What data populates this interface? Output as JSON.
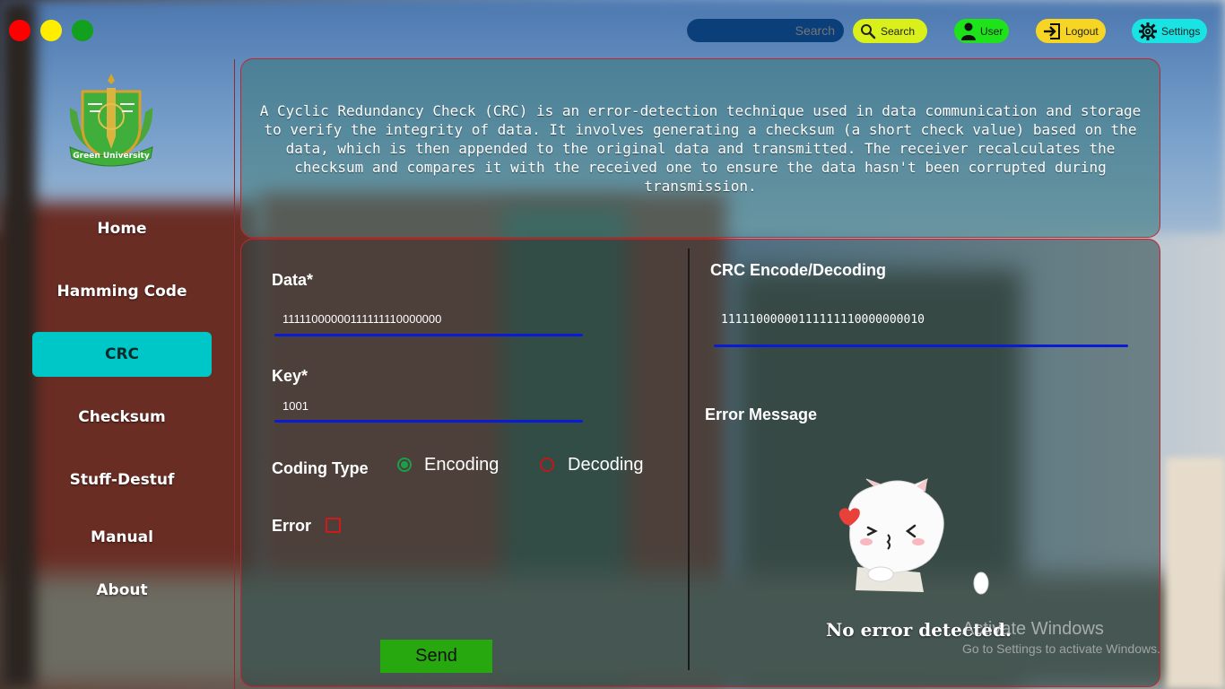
{
  "window": {
    "colors": {
      "close": "#ff0000",
      "minimize": "#ffee00",
      "maximize": "#12a01f"
    }
  },
  "topbar": {
    "search_placeholder": "Search",
    "search_button": "Search",
    "user_button": "User",
    "logout_button": "Logout",
    "settings_button": "Settings",
    "colors": {
      "search": "#d9f01a",
      "user": "#1ee21a",
      "logout": "#f7d524",
      "settings": "#19e3e3",
      "search_field": "#0b3f7a"
    }
  },
  "sidebar": {
    "logo_text": "Green University",
    "items": [
      {
        "label": "Home",
        "active": false
      },
      {
        "label": "Hamming Code",
        "active": false
      },
      {
        "label": "CRC",
        "active": true
      },
      {
        "label": "Checksum",
        "active": false
      },
      {
        "label": "Stuff-Destuf",
        "active": false
      },
      {
        "label": "Manual",
        "active": false
      },
      {
        "label": "About",
        "active": false
      }
    ],
    "active_color": "#00c7c7"
  },
  "info": {
    "text": "A Cyclic Redundancy Check (CRC) is an error-detection technique used in data communication and storage to verify the integrity of data. It involves generating a checksum (a short check value) based on the data, which is then appended to the original data and transmitted. The receiver recalculates the checksum and compares it with the received one to ensure the data hasn't been corrupted during transmission."
  },
  "form": {
    "data_label": "Data*",
    "data_value": "11111000000111111110000000",
    "key_label": "Key*",
    "key_value": "1001",
    "coding_type_label": "Coding Type",
    "encoding_label": "Encoding",
    "decoding_label": "Decoding",
    "selected_coding": "Encoding",
    "error_label": "Error",
    "error_checked": false,
    "send_label": "Send"
  },
  "result": {
    "title": "CRC Encode/Decoding",
    "value": "11111000000111111110000000010",
    "error_message_label": "Error Message",
    "status": "No error detected."
  },
  "watermark": {
    "title": "Activate Windows",
    "subtitle": "Go to Settings to activate Windows."
  }
}
